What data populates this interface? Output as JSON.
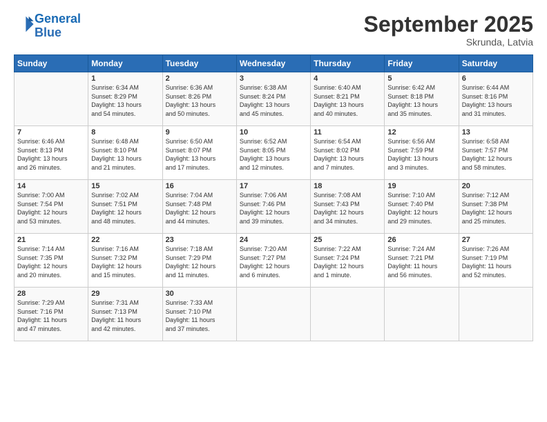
{
  "header": {
    "logo_line1": "General",
    "logo_line2": "Blue",
    "month": "September 2025",
    "location": "Skrunda, Latvia"
  },
  "days_of_week": [
    "Sunday",
    "Monday",
    "Tuesday",
    "Wednesday",
    "Thursday",
    "Friday",
    "Saturday"
  ],
  "weeks": [
    [
      {
        "day": "",
        "info": ""
      },
      {
        "day": "1",
        "info": "Sunrise: 6:34 AM\nSunset: 8:29 PM\nDaylight: 13 hours\nand 54 minutes."
      },
      {
        "day": "2",
        "info": "Sunrise: 6:36 AM\nSunset: 8:26 PM\nDaylight: 13 hours\nand 50 minutes."
      },
      {
        "day": "3",
        "info": "Sunrise: 6:38 AM\nSunset: 8:24 PM\nDaylight: 13 hours\nand 45 minutes."
      },
      {
        "day": "4",
        "info": "Sunrise: 6:40 AM\nSunset: 8:21 PM\nDaylight: 13 hours\nand 40 minutes."
      },
      {
        "day": "5",
        "info": "Sunrise: 6:42 AM\nSunset: 8:18 PM\nDaylight: 13 hours\nand 35 minutes."
      },
      {
        "day": "6",
        "info": "Sunrise: 6:44 AM\nSunset: 8:16 PM\nDaylight: 13 hours\nand 31 minutes."
      }
    ],
    [
      {
        "day": "7",
        "info": "Sunrise: 6:46 AM\nSunset: 8:13 PM\nDaylight: 13 hours\nand 26 minutes."
      },
      {
        "day": "8",
        "info": "Sunrise: 6:48 AM\nSunset: 8:10 PM\nDaylight: 13 hours\nand 21 minutes."
      },
      {
        "day": "9",
        "info": "Sunrise: 6:50 AM\nSunset: 8:07 PM\nDaylight: 13 hours\nand 17 minutes."
      },
      {
        "day": "10",
        "info": "Sunrise: 6:52 AM\nSunset: 8:05 PM\nDaylight: 13 hours\nand 12 minutes."
      },
      {
        "day": "11",
        "info": "Sunrise: 6:54 AM\nSunset: 8:02 PM\nDaylight: 13 hours\nand 7 minutes."
      },
      {
        "day": "12",
        "info": "Sunrise: 6:56 AM\nSunset: 7:59 PM\nDaylight: 13 hours\nand 3 minutes."
      },
      {
        "day": "13",
        "info": "Sunrise: 6:58 AM\nSunset: 7:57 PM\nDaylight: 12 hours\nand 58 minutes."
      }
    ],
    [
      {
        "day": "14",
        "info": "Sunrise: 7:00 AM\nSunset: 7:54 PM\nDaylight: 12 hours\nand 53 minutes."
      },
      {
        "day": "15",
        "info": "Sunrise: 7:02 AM\nSunset: 7:51 PM\nDaylight: 12 hours\nand 48 minutes."
      },
      {
        "day": "16",
        "info": "Sunrise: 7:04 AM\nSunset: 7:48 PM\nDaylight: 12 hours\nand 44 minutes."
      },
      {
        "day": "17",
        "info": "Sunrise: 7:06 AM\nSunset: 7:46 PM\nDaylight: 12 hours\nand 39 minutes."
      },
      {
        "day": "18",
        "info": "Sunrise: 7:08 AM\nSunset: 7:43 PM\nDaylight: 12 hours\nand 34 minutes."
      },
      {
        "day": "19",
        "info": "Sunrise: 7:10 AM\nSunset: 7:40 PM\nDaylight: 12 hours\nand 29 minutes."
      },
      {
        "day": "20",
        "info": "Sunrise: 7:12 AM\nSunset: 7:38 PM\nDaylight: 12 hours\nand 25 minutes."
      }
    ],
    [
      {
        "day": "21",
        "info": "Sunrise: 7:14 AM\nSunset: 7:35 PM\nDaylight: 12 hours\nand 20 minutes."
      },
      {
        "day": "22",
        "info": "Sunrise: 7:16 AM\nSunset: 7:32 PM\nDaylight: 12 hours\nand 15 minutes."
      },
      {
        "day": "23",
        "info": "Sunrise: 7:18 AM\nSunset: 7:29 PM\nDaylight: 12 hours\nand 11 minutes."
      },
      {
        "day": "24",
        "info": "Sunrise: 7:20 AM\nSunset: 7:27 PM\nDaylight: 12 hours\nand 6 minutes."
      },
      {
        "day": "25",
        "info": "Sunrise: 7:22 AM\nSunset: 7:24 PM\nDaylight: 12 hours\nand 1 minute."
      },
      {
        "day": "26",
        "info": "Sunrise: 7:24 AM\nSunset: 7:21 PM\nDaylight: 11 hours\nand 56 minutes."
      },
      {
        "day": "27",
        "info": "Sunrise: 7:26 AM\nSunset: 7:19 PM\nDaylight: 11 hours\nand 52 minutes."
      }
    ],
    [
      {
        "day": "28",
        "info": "Sunrise: 7:29 AM\nSunset: 7:16 PM\nDaylight: 11 hours\nand 47 minutes."
      },
      {
        "day": "29",
        "info": "Sunrise: 7:31 AM\nSunset: 7:13 PM\nDaylight: 11 hours\nand 42 minutes."
      },
      {
        "day": "30",
        "info": "Sunrise: 7:33 AM\nSunset: 7:10 PM\nDaylight: 11 hours\nand 37 minutes."
      },
      {
        "day": "",
        "info": ""
      },
      {
        "day": "",
        "info": ""
      },
      {
        "day": "",
        "info": ""
      },
      {
        "day": "",
        "info": ""
      }
    ]
  ]
}
